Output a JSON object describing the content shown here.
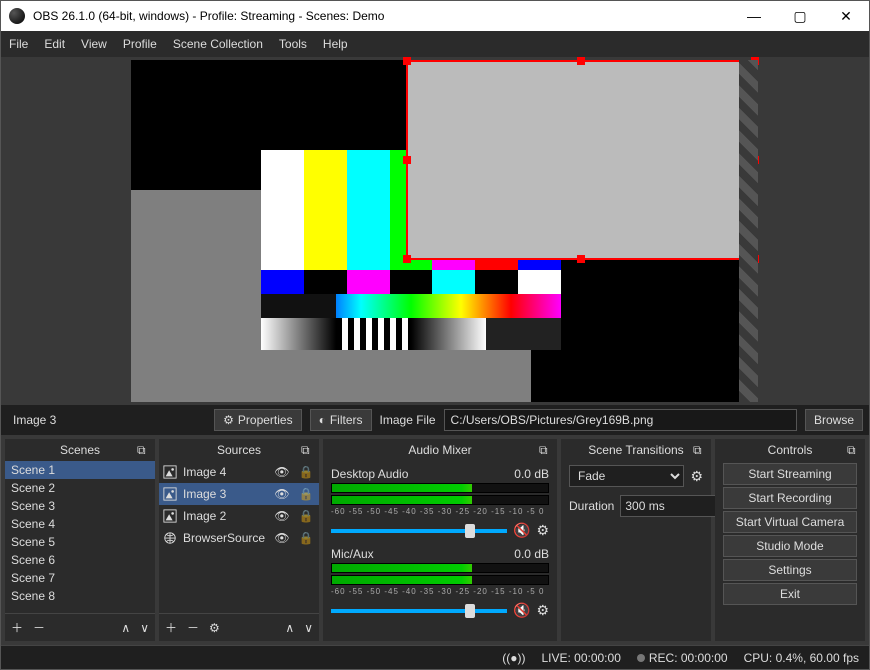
{
  "title": "OBS 26.1.0 (64-bit, windows) - Profile: Streaming - Scenes: Demo",
  "menu": [
    "File",
    "Edit",
    "View",
    "Profile",
    "Scene Collection",
    "Tools",
    "Help"
  ],
  "context": {
    "selected_source": "Image 3",
    "properties": "Properties",
    "filters": "Filters",
    "field_label": "Image File",
    "path": "C:/Users/OBS/Pictures/Grey169B.png",
    "browse": "Browse"
  },
  "panels": {
    "scenes": {
      "title": "Scenes",
      "items": [
        "Scene 1",
        "Scene 2",
        "Scene 3",
        "Scene 4",
        "Scene 5",
        "Scene 6",
        "Scene 7",
        "Scene 8"
      ],
      "selected": 0
    },
    "sources": {
      "title": "Sources",
      "items": [
        {
          "name": "Image 4",
          "kind": "image",
          "visible": true,
          "locked": false,
          "sel": false
        },
        {
          "name": "Image 3",
          "kind": "image",
          "visible": true,
          "locked": false,
          "sel": true
        },
        {
          "name": "Image 2",
          "kind": "image",
          "visible": true,
          "locked": false,
          "sel": false
        },
        {
          "name": "BrowserSource",
          "kind": "browser",
          "visible": true,
          "locked": false,
          "sel": false
        }
      ]
    },
    "mixer": {
      "title": "Audio Mixer",
      "channels": [
        {
          "name": "Desktop Audio",
          "level": "0.0 dB"
        },
        {
          "name": "Mic/Aux",
          "level": "0.0 dB"
        }
      ],
      "ticks": "-60  -55  -50  -45  -40  -35  -30  -25  -20  -15  -10  -5   0"
    },
    "transitions": {
      "title": "Scene Transitions",
      "type": "Fade",
      "duration_label": "Duration",
      "duration": "300 ms"
    },
    "controls": {
      "title": "Controls",
      "buttons": [
        "Start Streaming",
        "Start Recording",
        "Start Virtual Camera",
        "Studio Mode",
        "Settings",
        "Exit"
      ]
    }
  },
  "status": {
    "live": "LIVE: 00:00:00",
    "rec": "REC: 00:00:00",
    "cpu": "CPU: 0.4%, 60.00 fps"
  }
}
